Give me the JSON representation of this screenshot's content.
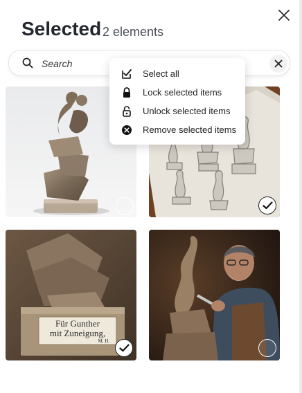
{
  "header": {
    "title": "Selected",
    "count_label": "2 elements"
  },
  "search": {
    "placeholder": "Search",
    "value": ""
  },
  "context_menu": {
    "items": [
      {
        "label": "Select all",
        "icon": "select-all-icon"
      },
      {
        "label": "Lock selected items",
        "icon": "lock-icon"
      },
      {
        "label": "Unlock selected items",
        "icon": "unlock-icon"
      },
      {
        "label": "Remove selected items",
        "icon": "remove-circle-icon"
      }
    ]
  },
  "gallery": {
    "items": [
      {
        "subject": "abstract stone figure sculpture",
        "selected": false
      },
      {
        "subject": "pencil sketch of sculptures",
        "selected": true
      },
      {
        "subject": "sculpture base with engraved plaque",
        "selected": true,
        "plaque_line1": "Für Gunther",
        "plaque_line2": "mit Zuneigung,",
        "plaque_line3": "M. H."
      },
      {
        "subject": "old sculptor carving stone",
        "selected": false
      }
    ]
  },
  "colors": {
    "accent": "#1c1c1e",
    "check_ring": "#ffffff"
  }
}
